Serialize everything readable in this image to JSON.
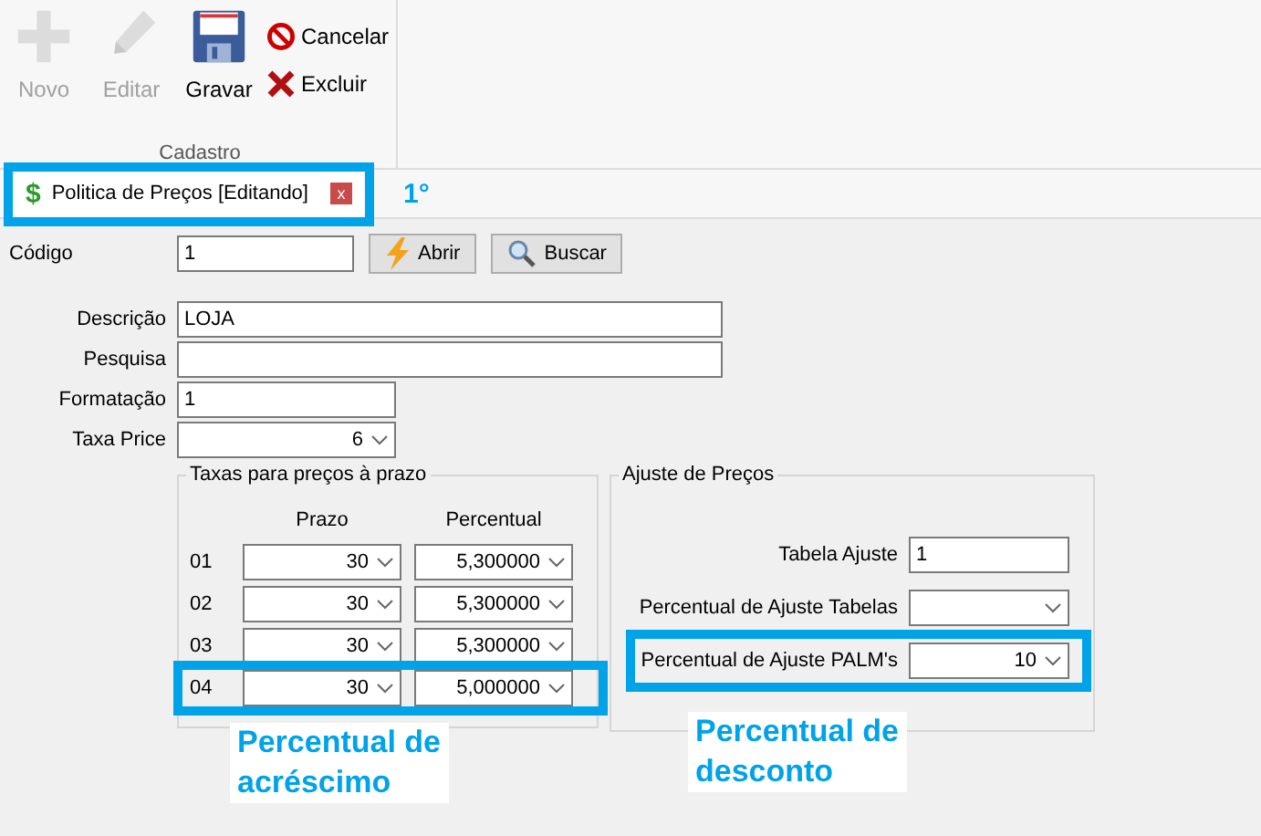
{
  "toolbar": {
    "large_buttons": [
      {
        "label": "Novo",
        "kind": "plus",
        "disabled": true
      },
      {
        "label": "Editar",
        "kind": "pencil",
        "disabled": true
      },
      {
        "label": "Gravar",
        "kind": "floppy",
        "disabled": false
      }
    ],
    "small_buttons": [
      {
        "label": "Cancelar",
        "kind": "cancel"
      },
      {
        "label": "Excluir",
        "kind": "delete"
      }
    ],
    "group_label": "Cadastro"
  },
  "tab": {
    "icon": "$",
    "title": "Politica de Preços [Editando]",
    "close": "x",
    "highlighted": true
  },
  "codigo": {
    "label": "Código",
    "value": "1",
    "buttons": [
      {
        "label": "Abrir",
        "kind": "bolt"
      },
      {
        "label": "Buscar",
        "kind": "search"
      }
    ]
  },
  "fields": [
    {
      "label": "Descrição",
      "value": "LOJA",
      "kind": "text"
    },
    {
      "label": "Pesquisa",
      "kind": "text"
    },
    {
      "label": "Formatação",
      "value": "1",
      "kind": "text"
    },
    {
      "label": "Taxa Price",
      "value": "6",
      "kind": "combo"
    }
  ],
  "taxas": {
    "title": "Taxas para preços à prazo",
    "columns": [
      "Prazo",
      "Percentual"
    ],
    "rows": [
      {
        "label": "01",
        "prazo": "30",
        "percentual": "5,300000",
        "highlighted": false
      },
      {
        "label": "02",
        "prazo": "30",
        "percentual": "5,300000",
        "highlighted": false
      },
      {
        "label": "03",
        "prazo": "30",
        "percentual": "5,300000",
        "highlighted": false
      },
      {
        "label": "04",
        "prazo": "30",
        "percentual": "5,000000",
        "highlighted": true
      }
    ]
  },
  "ajuste": {
    "title": "Ajuste de Preços",
    "fields": [
      {
        "label": "Tabela Ajuste",
        "value": "1",
        "kind": "text",
        "highlighted": false
      },
      {
        "label": "Percentual de Ajuste Tabelas",
        "kind": "combo",
        "highlighted": false
      },
      {
        "label": "Percentual de Ajuste PALM's",
        "value": "10",
        "kind": "combo",
        "highlighted": true
      }
    ]
  },
  "annotations": [
    {
      "text": "1°"
    },
    {
      "text": "Percentual de\nacréscimo"
    },
    {
      "text": "Percentual de\ndesconto"
    }
  ]
}
